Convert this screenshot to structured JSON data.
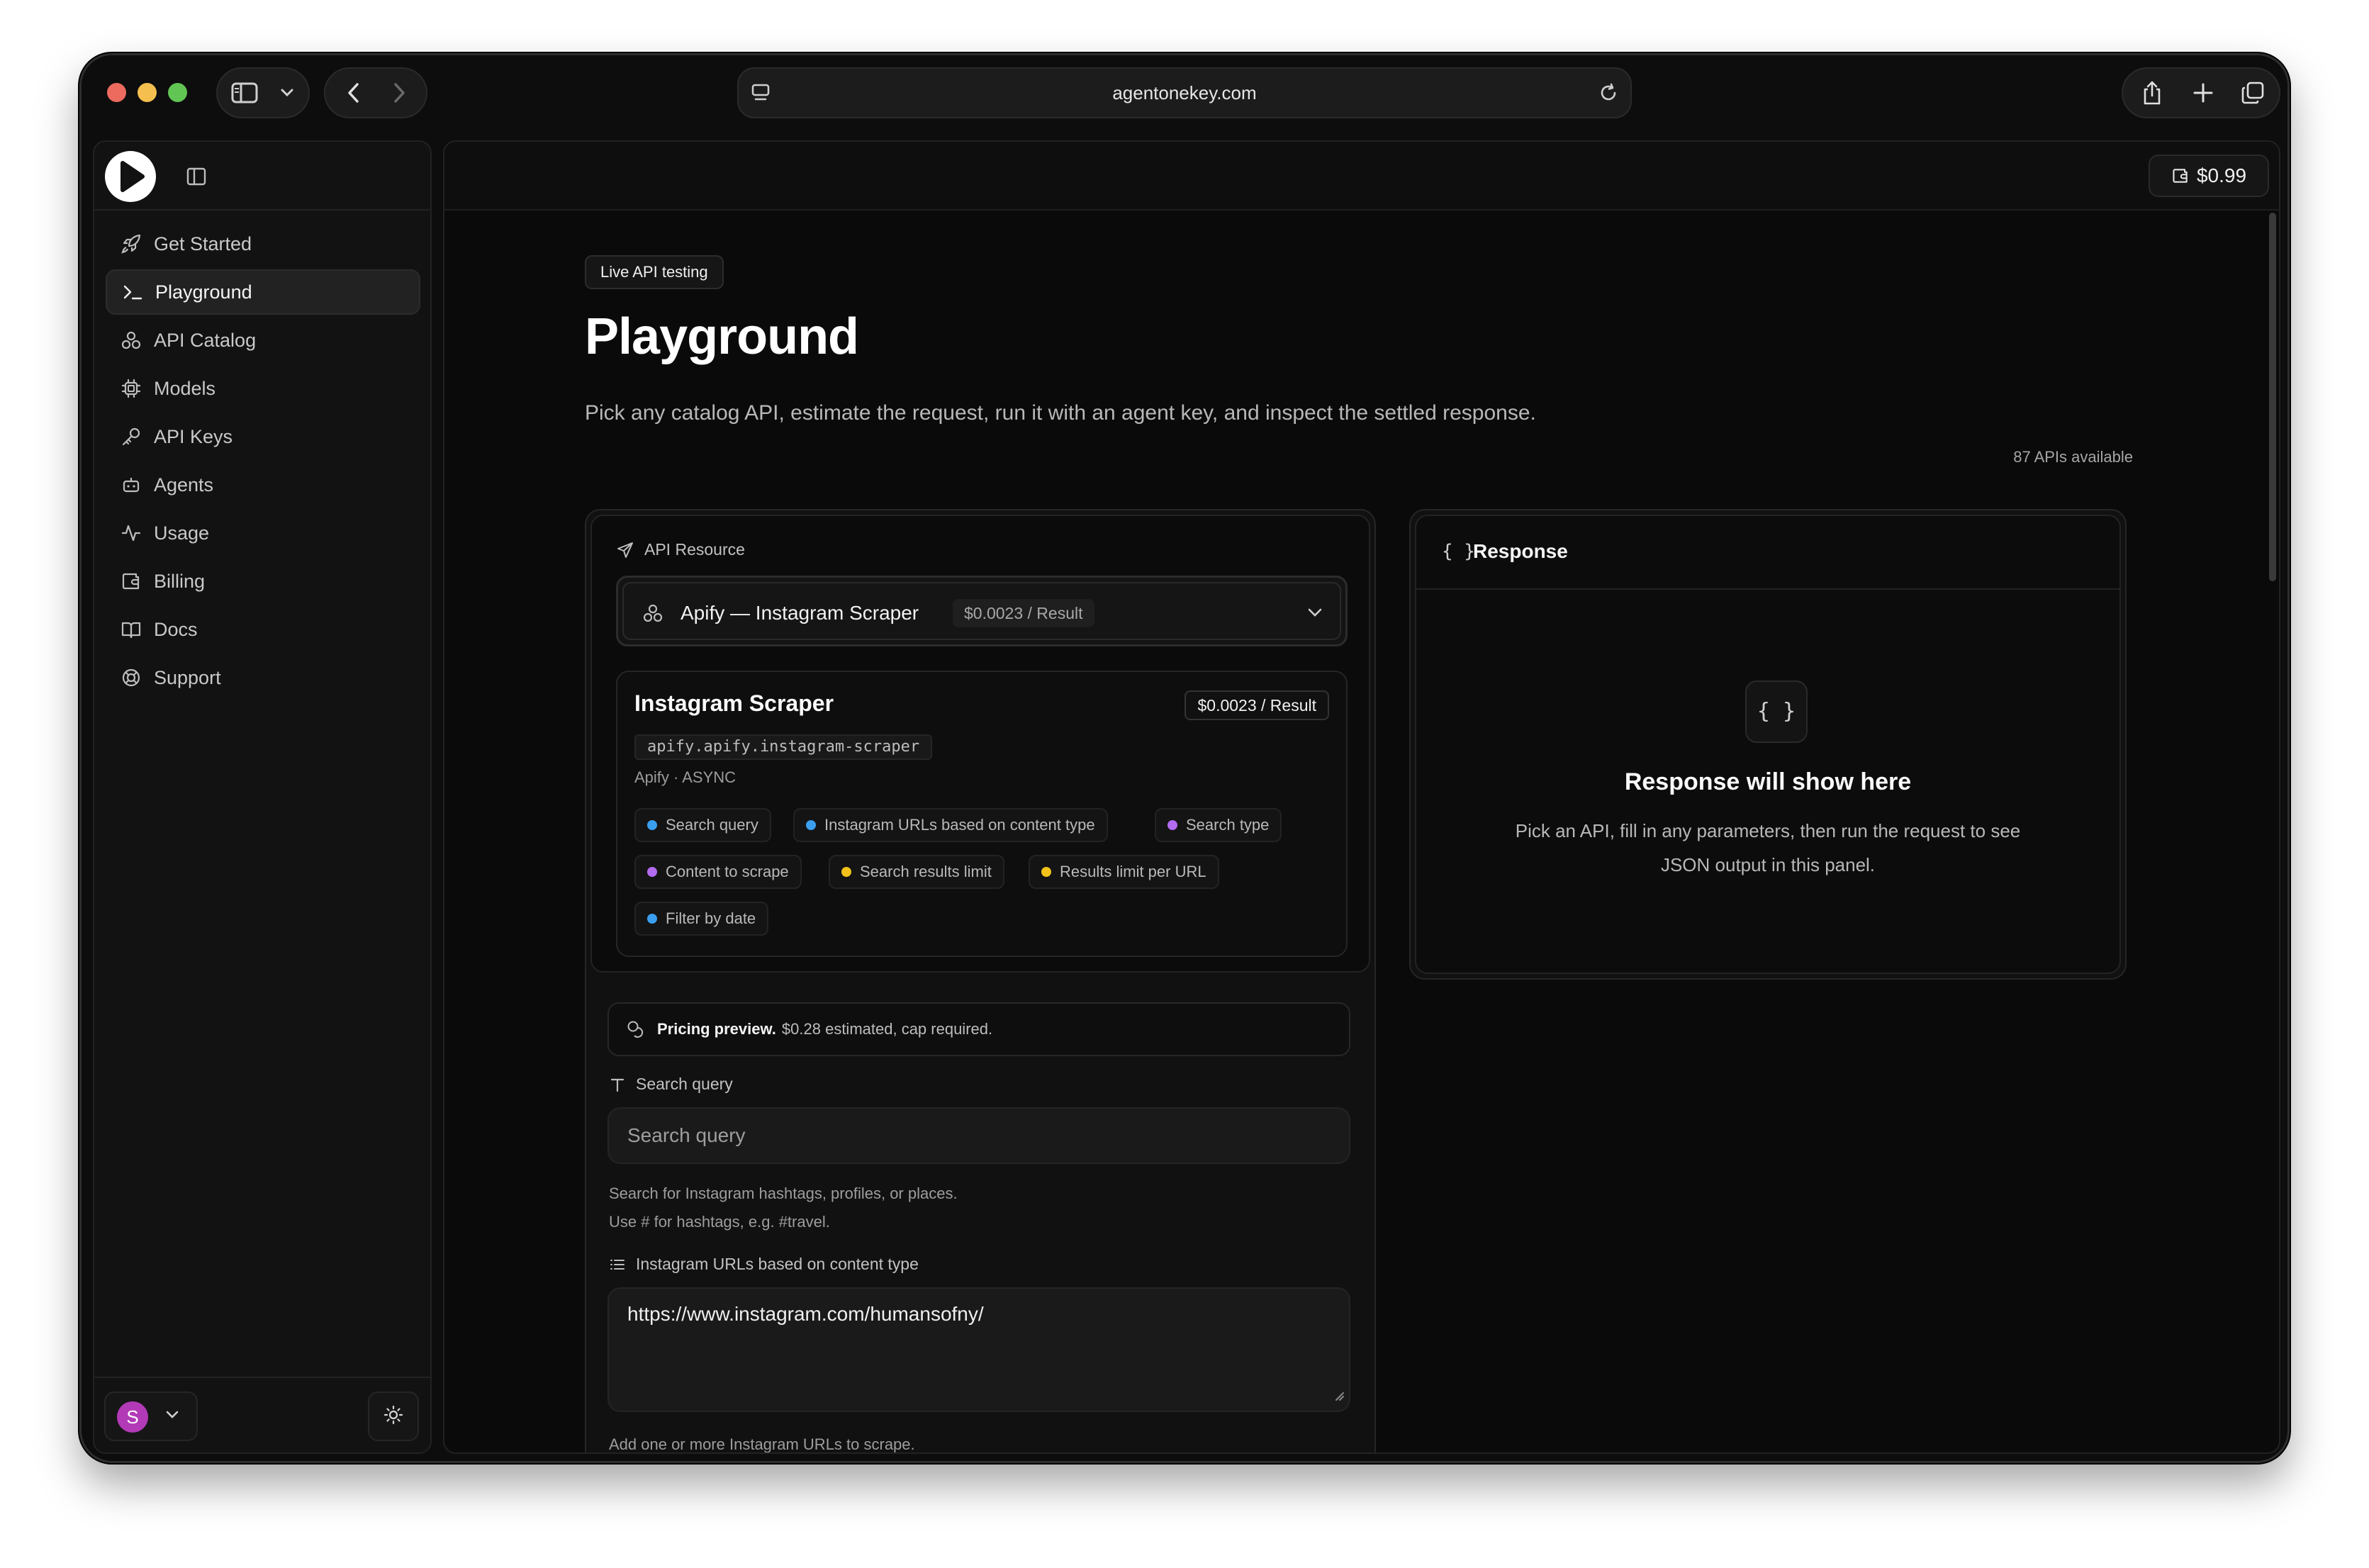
{
  "browser": {
    "url": "agentonekey.com"
  },
  "sidebar": {
    "items": [
      {
        "label": "Get Started",
        "icon": "rocket-icon"
      },
      {
        "label": "Playground",
        "icon": "terminal-icon",
        "active": true
      },
      {
        "label": "API Catalog",
        "icon": "catalog-icon"
      },
      {
        "label": "Models",
        "icon": "chip-icon"
      },
      {
        "label": "API Keys",
        "icon": "key-icon"
      },
      {
        "label": "Agents",
        "icon": "bot-icon"
      },
      {
        "label": "Usage",
        "icon": "activity-icon"
      },
      {
        "label": "Billing",
        "icon": "wallet-icon"
      },
      {
        "label": "Docs",
        "icon": "book-icon"
      },
      {
        "label": "Support",
        "icon": "lifebuoy-icon"
      }
    ],
    "user_initial": "S"
  },
  "header": {
    "balance": "$0.99"
  },
  "page": {
    "badge": "Live API testing",
    "title": "Playground",
    "description": "Pick any catalog API, estimate the request, run it with an agent key, and inspect the settled response.",
    "api_count": "87 APIs available"
  },
  "resource": {
    "label": "API Resource",
    "selected_name": "Apify — Instagram Scraper",
    "selected_price": "$0.0023 / Result"
  },
  "api": {
    "title": "Instagram Scraper",
    "price": "$0.0023 / Result",
    "slug": "apify.apify.instagram-scraper",
    "meta": "Apify · ASYNC",
    "tags": [
      {
        "label": "Search query",
        "color": "#3b9ff0"
      },
      {
        "label": "Instagram URLs based on content type",
        "color": "#3b9ff0"
      },
      {
        "label": "Search type",
        "color": "#b36bf0"
      },
      {
        "label": "Content to scrape",
        "color": "#b36bf0"
      },
      {
        "label": "Search results limit",
        "color": "#f2c21b"
      },
      {
        "label": "Results limit per URL",
        "color": "#f2c21b"
      },
      {
        "label": "Filter by date",
        "color": "#3b9ff0"
      }
    ]
  },
  "form": {
    "pricing_bold": "Pricing preview.",
    "pricing_text": "$0.28 estimated, cap required.",
    "search_query_label": "Search query",
    "search_query_placeholder": "Search query",
    "search_query_help_1": "Search for Instagram hashtags, profiles, or places.",
    "search_query_help_2": "Use # for hashtags, e.g. #travel.",
    "urls_label": "Instagram URLs based on content type",
    "urls_value": "https://www.instagram.com/humansofny/",
    "urls_help": "Add one or more Instagram URLs to scrape."
  },
  "response": {
    "header": "Response",
    "braces": "{ }",
    "empty_title": "Response will show here",
    "empty_desc": "Pick an API, fill in any parameters, then run the request to see JSON output in this panel."
  }
}
